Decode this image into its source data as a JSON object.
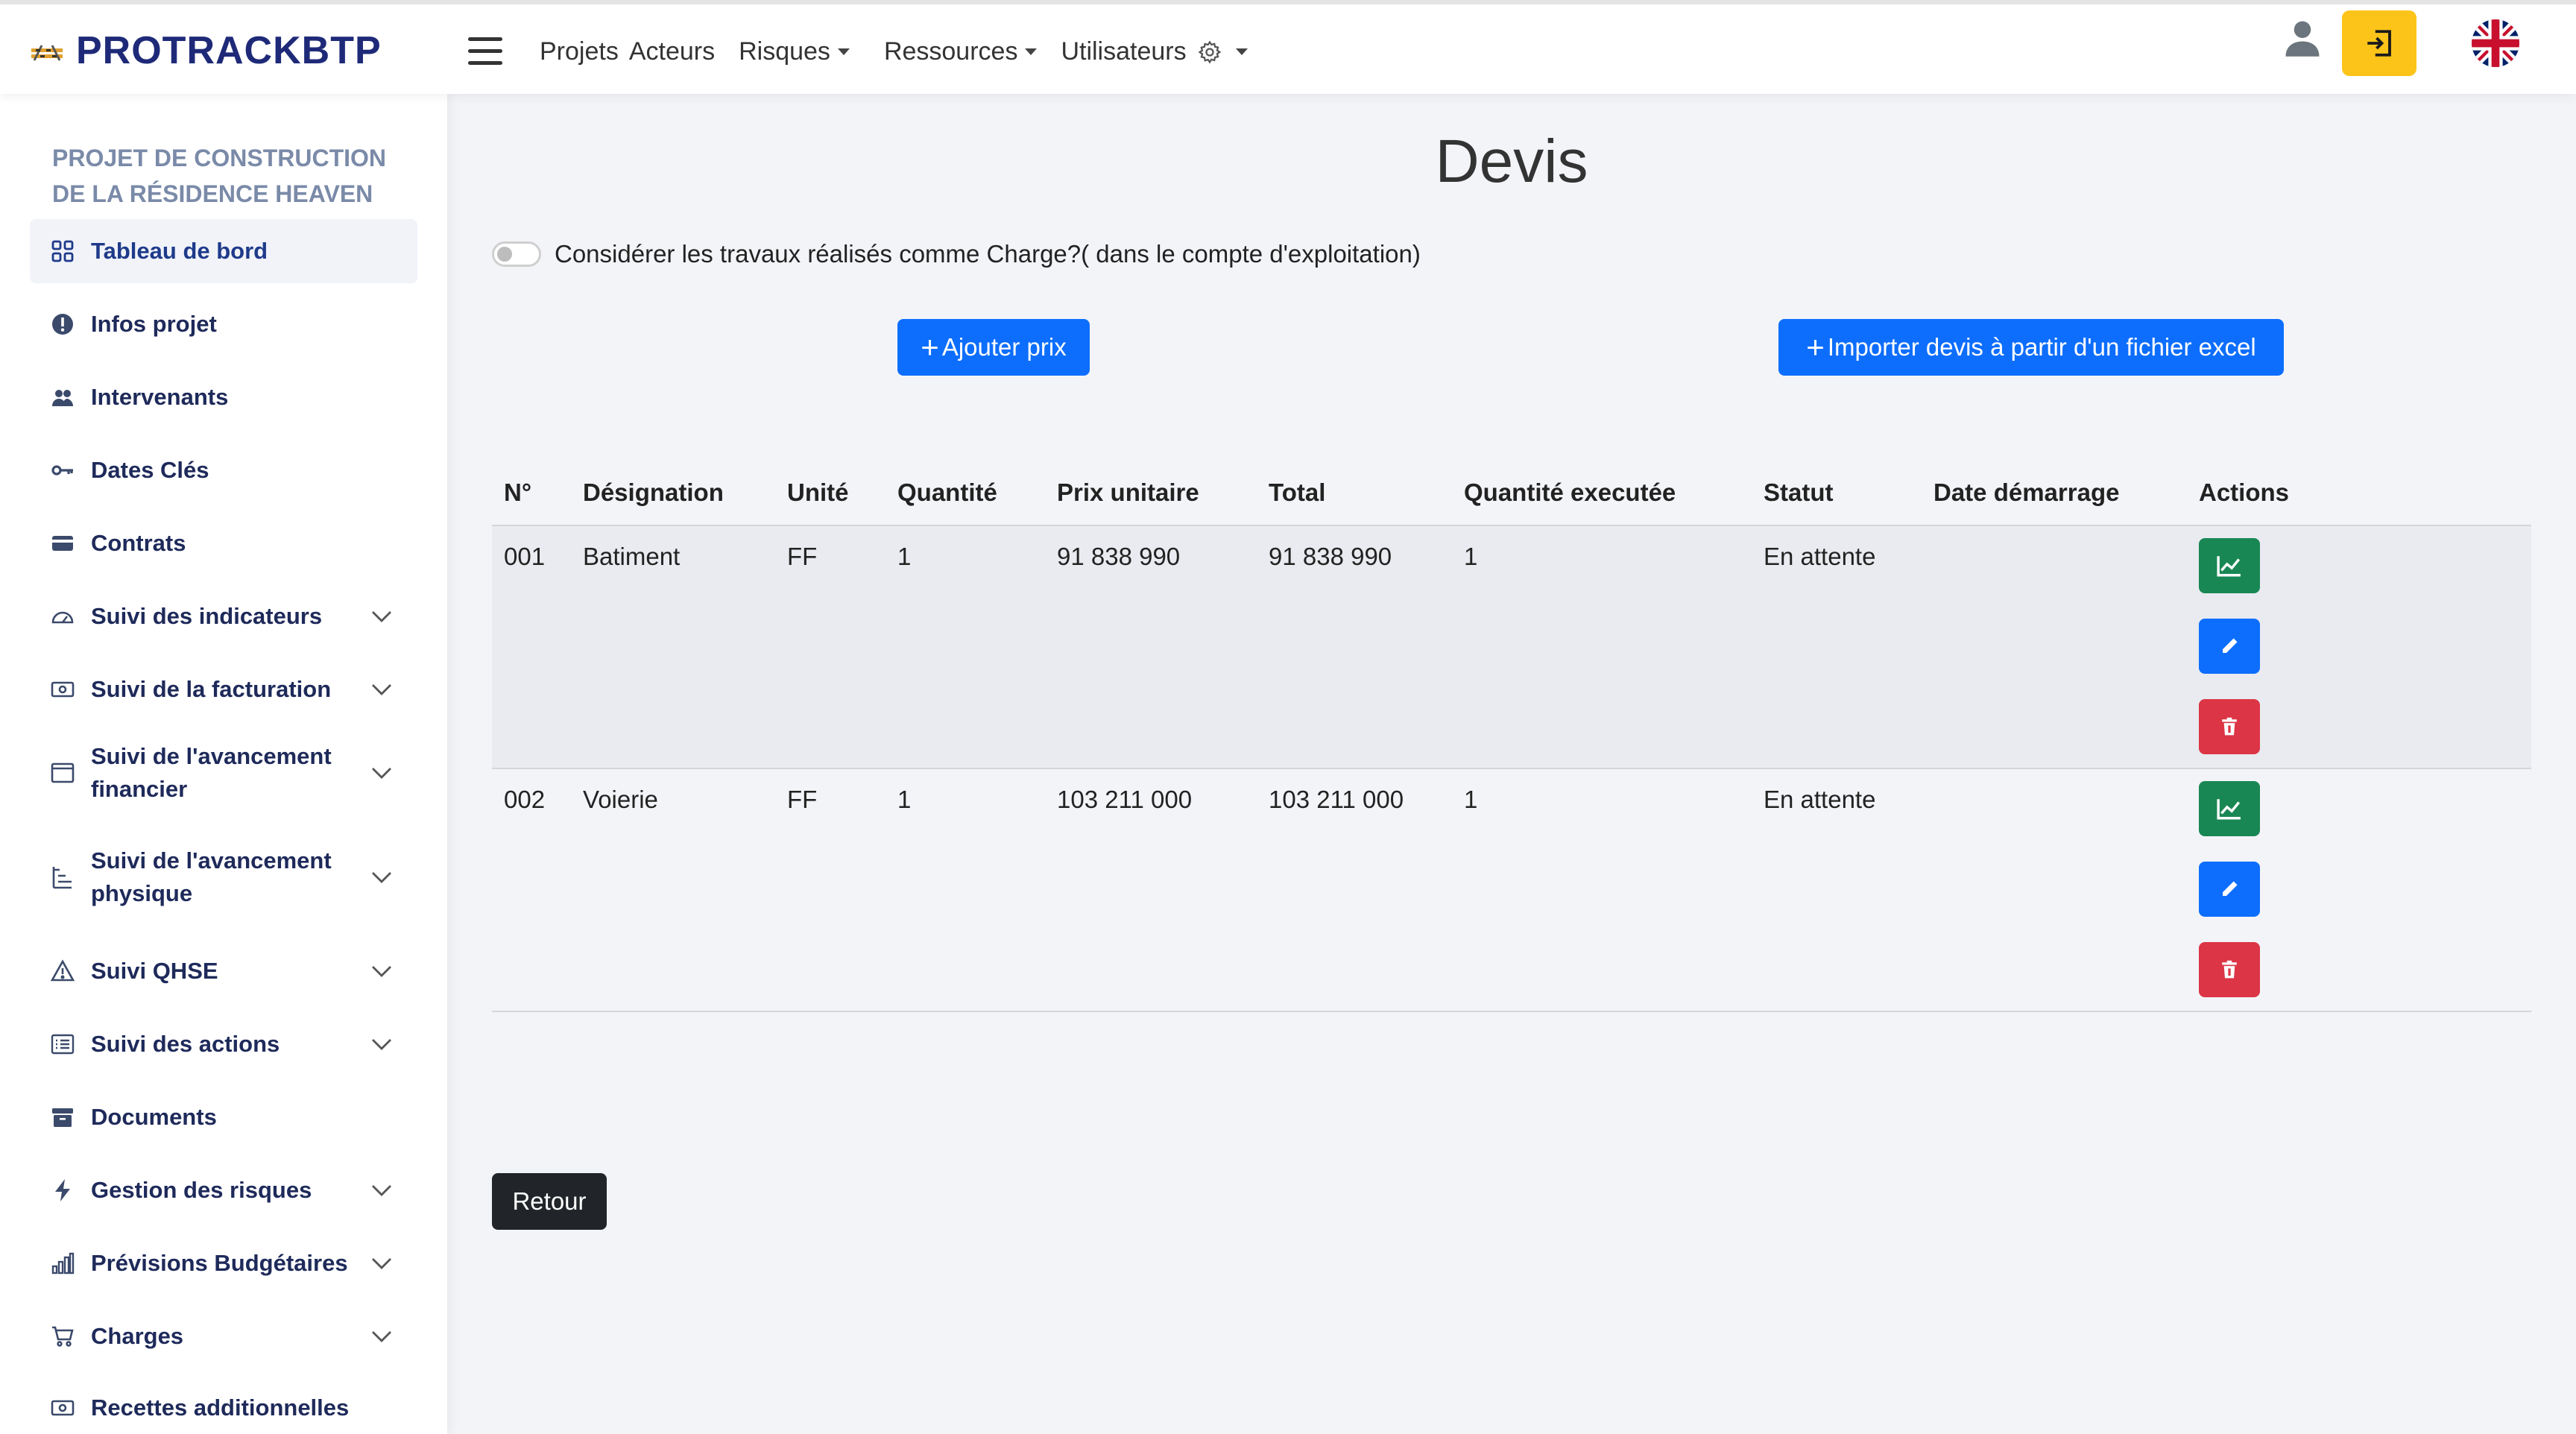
{
  "header": {
    "brand": "PROTRACKBTP",
    "nav": {
      "projets": "Projets",
      "acteurs": "Acteurs",
      "risques": "Risques",
      "ressources": "Ressources",
      "utilisateurs": "Utilisateurs"
    },
    "accent_logout": "#fcc419"
  },
  "sidebar": {
    "project_name": "PROJET DE CONSTRUCTION DE LA RÉSIDENCE HEAVEN",
    "items": [
      {
        "label": "Tableau de bord",
        "icon": "grid-icon",
        "active": true
      },
      {
        "label": "Infos projet",
        "icon": "info-icon"
      },
      {
        "label": "Intervenants",
        "icon": "people-icon"
      },
      {
        "label": "Dates Clés",
        "icon": "key-icon"
      },
      {
        "label": "Contrats",
        "icon": "card-icon"
      },
      {
        "label": "Suivi des indicateurs",
        "icon": "speedometer-icon",
        "expandable": true
      },
      {
        "label": "Suivi de la facturation",
        "icon": "cash-icon",
        "expandable": true
      },
      {
        "label": "Suivi de l'avancement financier",
        "icon": "window-icon",
        "expandable": true
      },
      {
        "label": "Suivi de l'avancement physique",
        "icon": "list-indent-icon",
        "expandable": true
      },
      {
        "label": "Suivi QHSE",
        "icon": "warning-icon",
        "expandable": true
      },
      {
        "label": "Suivi des actions",
        "icon": "checklist-icon",
        "expandable": true
      },
      {
        "label": "Documents",
        "icon": "archive-icon"
      },
      {
        "label": "Gestion des risques",
        "icon": "lightning-icon",
        "expandable": true
      },
      {
        "label": "Prévisions Budgétaires",
        "icon": "bar-chart-icon",
        "expandable": true
      },
      {
        "label": "Charges",
        "icon": "cart-icon",
        "expandable": true
      },
      {
        "label": "Recettes additionnelles",
        "icon": "cash-icon"
      }
    ]
  },
  "main": {
    "title": "Devis",
    "toggle_label": "Considérer les travaux réalisés comme Charge?( dans le compte d'exploitation)",
    "add_price_label": "Ajouter prix",
    "import_label": "Importer devis à partir d'un fichier excel",
    "back_label": "Retour",
    "table": {
      "headers": [
        "N°",
        "Désignation",
        "Unité",
        "Quantité",
        "Prix unitaire",
        "Total",
        "Quantité executée",
        "Statut",
        "Date démarrage",
        "Actions"
      ],
      "rows": [
        {
          "num": "001",
          "designation": "Batiment",
          "unite": "FF",
          "quantite": "1",
          "prix_unitaire": "91 838 990",
          "total": "91 838 990",
          "quantite_executee": "1",
          "statut": "En attente",
          "date_demarrage": ""
        },
        {
          "num": "002",
          "designation": "Voierie",
          "unite": "FF",
          "quantite": "1",
          "prix_unitaire": "103 211 000",
          "total": "103 211 000",
          "quantite_executee": "1",
          "statut": "En attente",
          "date_demarrage": ""
        }
      ]
    },
    "colors": {
      "primary": "#0d6efd",
      "success": "#198754",
      "danger": "#dc3545",
      "dark": "#212529"
    }
  }
}
